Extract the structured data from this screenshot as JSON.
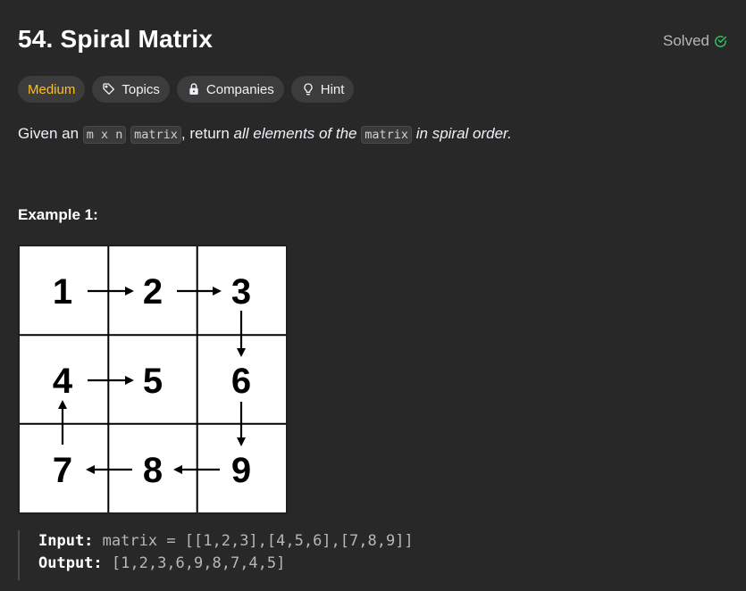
{
  "problem": {
    "number_title": "54. Spiral Matrix",
    "status": "Solved",
    "colors": {
      "success": "#2cbb5d",
      "medium": "#ffc01e"
    }
  },
  "tags": [
    {
      "label": "Medium",
      "icon": ""
    },
    {
      "label": "Topics",
      "icon": "tag-icon"
    },
    {
      "label": "Companies",
      "icon": "lock-icon"
    },
    {
      "label": "Hint",
      "icon": "lightbulb-icon"
    }
  ],
  "description": {
    "p1": "Given an ",
    "code1": "m x n",
    "p2": " ",
    "code2": "matrix",
    "p3": ", return ",
    "em1": "all elements of the",
    "p4": " ",
    "code3": "matrix",
    "p5": " ",
    "em2": "in spiral order."
  },
  "example": {
    "heading": "Example 1:",
    "grid_values": [
      "1",
      "2",
      "3",
      "4",
      "5",
      "6",
      "7",
      "8",
      "9"
    ],
    "input_label": "Input:",
    "input_value": "matrix = [[1,2,3],[4,5,6],[7,8,9]]",
    "output_label": "Output:",
    "output_value": "[1,2,3,6,9,8,7,4,5]"
  }
}
